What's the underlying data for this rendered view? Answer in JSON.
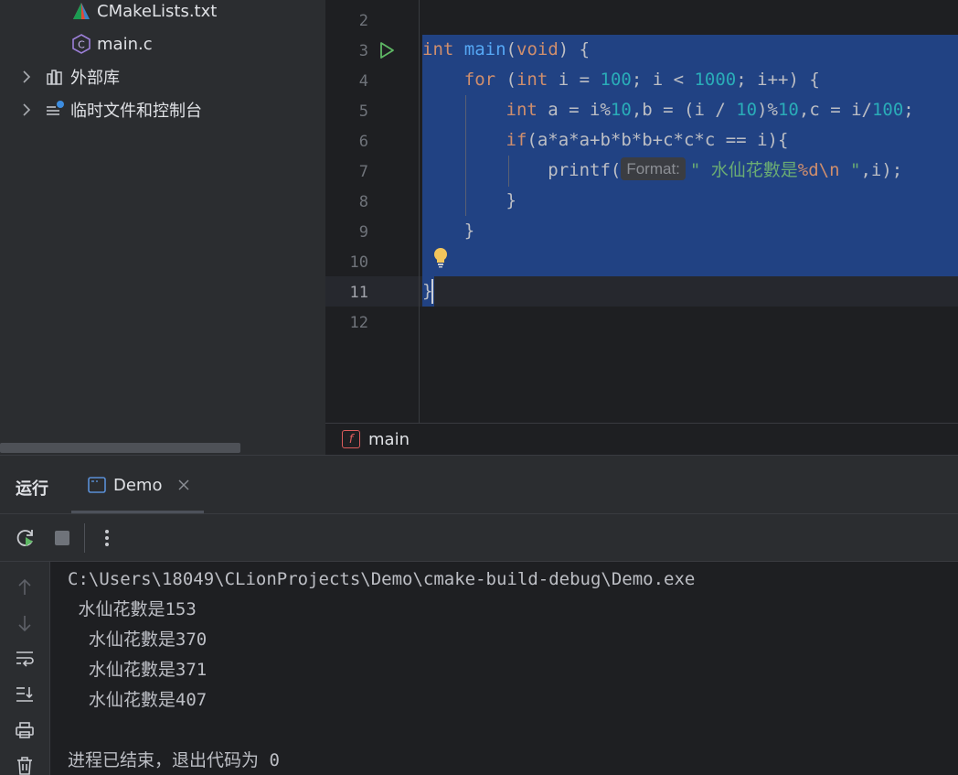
{
  "project_tree": {
    "items": [
      {
        "label": "CMakeLists.txt",
        "icon": "cmake-icon"
      },
      {
        "label": "main.c",
        "icon": "c-file-icon"
      },
      {
        "label": "外部库",
        "icon": "library-icon"
      },
      {
        "label": "临时文件和控制台",
        "icon": "scratches-icon"
      }
    ]
  },
  "editor": {
    "line_numbers": [
      "2",
      "3",
      "4",
      "5",
      "6",
      "7",
      "8",
      "9",
      "10",
      "11",
      "12"
    ],
    "current_line": "11",
    "hint_label": "Format:",
    "colors": {
      "keyword": "#cf8e6d",
      "function": "#56a8f5",
      "number": "#2aacb8",
      "string": "#6aab73",
      "selection": "#214283"
    }
  },
  "breadcrumb": {
    "icon_letter": "f",
    "label": "main"
  },
  "run_panel": {
    "title": "运行",
    "tab_label": "Demo",
    "console_lines": [
      "C:\\Users\\18049\\CLionProjects\\Demo\\cmake-build-debug\\Demo.exe",
      " 水仙花數是153",
      "  水仙花數是370",
      "  水仙花數是371",
      "  水仙花數是407",
      "",
      "进程已结束，退出代码为 0"
    ]
  }
}
